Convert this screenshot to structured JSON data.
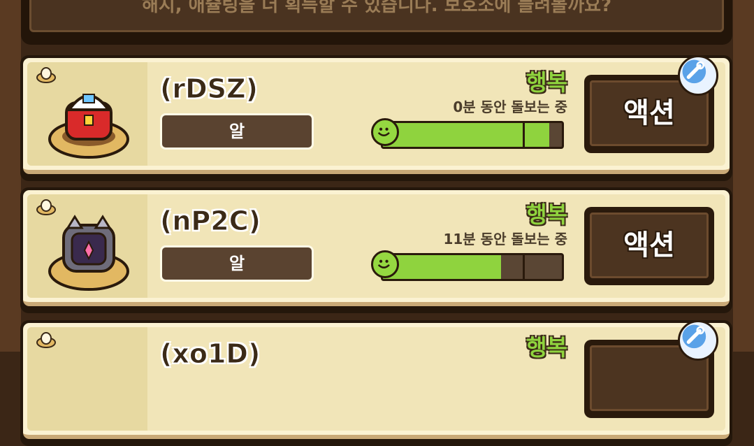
{
  "notice": {
    "text": "해지, 애슐링을 더 획득할 수 있습니다. 보호소에 들려볼까요?"
  },
  "cards": [
    {
      "name": "(rDSZ)",
      "stage": "알",
      "mood": "행복",
      "care_time": "0분 동안 돌보는 중",
      "happiness_fill": 0.93,
      "action_label": "액션",
      "has_wrench": true,
      "pet_icon": "red-egg-icon"
    },
    {
      "name": "(nP2C)",
      "stage": "알",
      "mood": "행복",
      "care_time": "11분 동안 돌보는 중",
      "happiness_fill": 0.66,
      "action_label": "액션",
      "has_wrench": false,
      "pet_icon": "armored-egg-icon"
    },
    {
      "name": "(xo1D)",
      "mood": "행복",
      "has_wrench": true,
      "pet_icon": "egg-icon"
    }
  ],
  "colors": {
    "happy_green": "#8fd33e",
    "card_bg": "#f1e5b8",
    "frame_dark": "#24170b"
  }
}
